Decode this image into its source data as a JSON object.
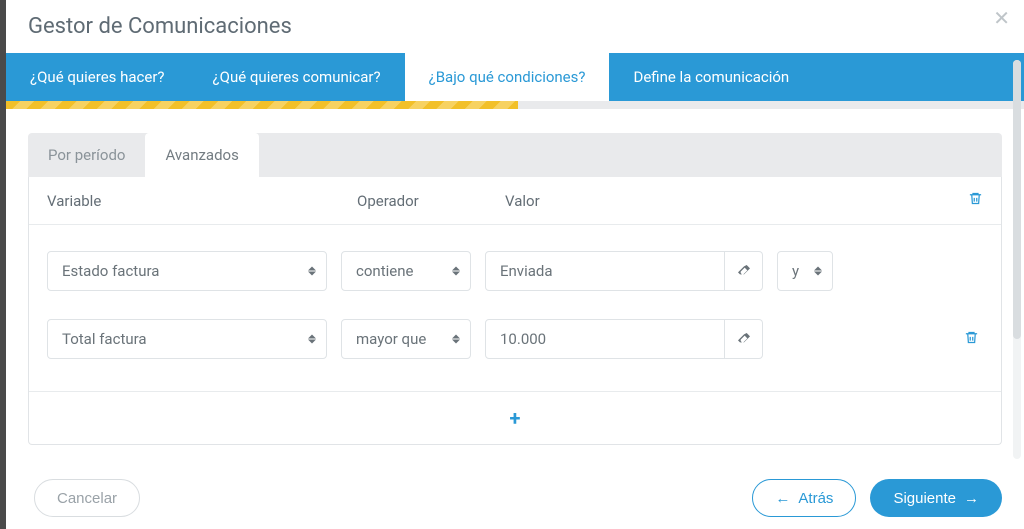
{
  "modal": {
    "title": "Gestor de Comunicaciones"
  },
  "wizard": {
    "tabs": [
      {
        "label": "¿Qué quieres hacer?"
      },
      {
        "label": "¿Qué quieres comunicar?"
      },
      {
        "label": "¿Bajo qué condiciones?"
      },
      {
        "label": "Define la comunicación"
      }
    ],
    "active_index": 2
  },
  "subtabs": {
    "items": [
      {
        "label": "Por período"
      },
      {
        "label": "Avanzados"
      }
    ],
    "active_index": 1
  },
  "columns": {
    "variable": "Variable",
    "operator": "Operador",
    "value": "Valor"
  },
  "rows": [
    {
      "variable": "Estado factura",
      "operator": "contiene",
      "value": "Enviada",
      "logic": "y"
    },
    {
      "variable": "Total factura",
      "operator": "mayor que",
      "value": "10.000",
      "logic": null
    }
  ],
  "footer": {
    "cancel": "Cancelar",
    "back": "Atrás",
    "next": "Siguiente"
  },
  "icons": {
    "trash": "trash-icon",
    "eraser": "eraser-icon",
    "plus": "plus-icon",
    "close": "close-icon",
    "arrow_left": "←",
    "arrow_right": "→"
  },
  "colors": {
    "primary": "#2a99d6",
    "progress": "#f2c029"
  }
}
